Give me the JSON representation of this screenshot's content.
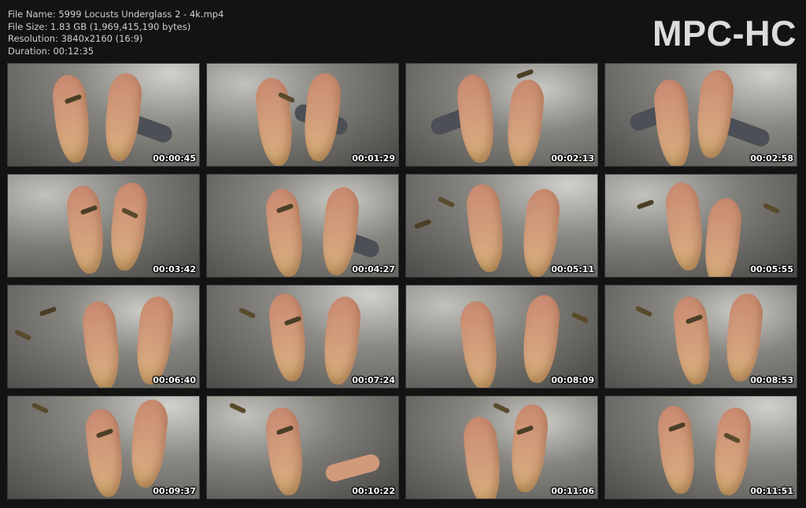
{
  "file_info": {
    "name": "File Name: 5999 Locusts Underglass 2 - 4k.mp4",
    "size": "File Size: 1.83 GB (1,969,415,190 bytes)",
    "resolution": "Resolution: 3840x2160 (16:9)",
    "duration": "Duration: 00:12:35"
  },
  "logo": "MPC-HC",
  "thumbnails": [
    {
      "timestamp": "00:00:45"
    },
    {
      "timestamp": "00:01:29"
    },
    {
      "timestamp": "00:02:13"
    },
    {
      "timestamp": "00:02:58"
    },
    {
      "timestamp": "00:03:42"
    },
    {
      "timestamp": "00:04:27"
    },
    {
      "timestamp": "00:05:11"
    },
    {
      "timestamp": "00:05:55"
    },
    {
      "timestamp": "00:06:40"
    },
    {
      "timestamp": "00:07:24"
    },
    {
      "timestamp": "00:08:09"
    },
    {
      "timestamp": "00:08:53"
    },
    {
      "timestamp": "00:09:37"
    },
    {
      "timestamp": "00:10:22"
    },
    {
      "timestamp": "00:11:06"
    },
    {
      "timestamp": "00:11:51"
    }
  ]
}
